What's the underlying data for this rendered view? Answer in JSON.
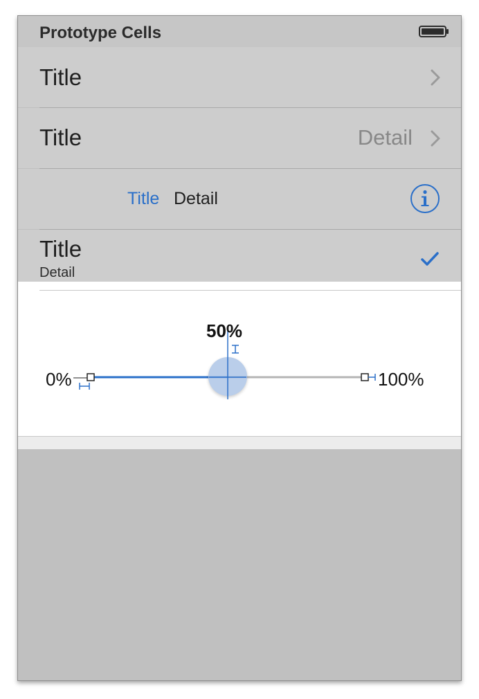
{
  "header": {
    "title": "Prototype Cells",
    "battery_icon": "battery-icon"
  },
  "cells": [
    {
      "title": "Title",
      "accessory": "chevron-right-icon"
    },
    {
      "title": "Title",
      "detail": "Detail",
      "accessory": "chevron-right-icon"
    },
    {
      "title": "Title",
      "detail": "Detail",
      "accessory": "info-icon"
    },
    {
      "title": "Title",
      "detail": "Detail",
      "accessory": "checkmark-icon"
    }
  ],
  "slider": {
    "value_label": "50%",
    "min_label": "0%",
    "max_label": "100%",
    "value": 0.5
  },
  "colors": {
    "accent": "#2a6fc9",
    "cell_background": "#cdcdcd",
    "canvas_background": "#c0c0c0"
  }
}
